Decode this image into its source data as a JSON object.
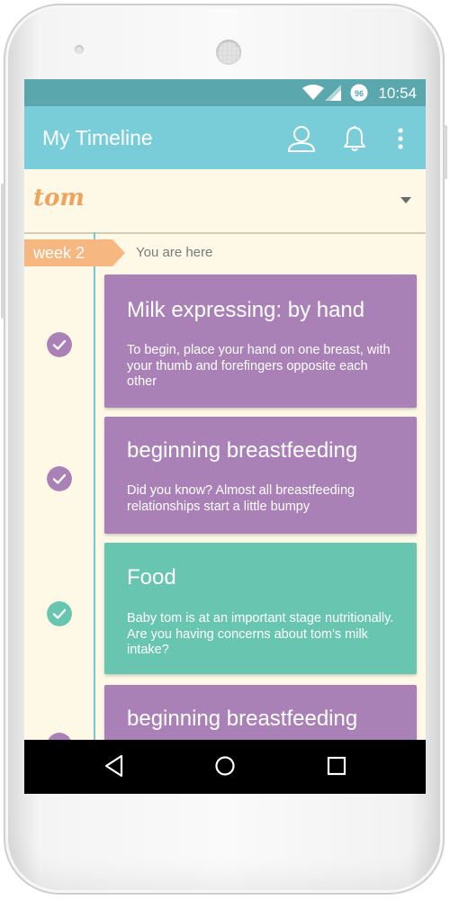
{
  "status_bar": {
    "time": "10:54",
    "icons": [
      "wifi-icon",
      "signal-icon",
      "notification-96-icon"
    ],
    "notification_badge": "96"
  },
  "app_bar": {
    "title": "My Timeline",
    "actions": [
      "profile-icon",
      "bell-icon",
      "more-vert-icon"
    ]
  },
  "child_selector": {
    "name": "tom"
  },
  "timeline": {
    "week_label": "week 2",
    "position_label": "You are here"
  },
  "cards": [
    {
      "title": "Milk expressing: by hand",
      "body": "To begin, place your hand on one breast, with your thumb and forefingers opposite each other",
      "color": "#a981b6",
      "completed": true
    },
    {
      "title": "beginning breastfeeding",
      "body": "Did you know? Almost all breastfeeding relationships start a little bumpy",
      "color": "#a981b6",
      "completed": true
    },
    {
      "title": "Food",
      "body": "Baby tom is at an important stage nutritionally. Are you having concerns about tom's milk intake?",
      "color": "#67c5b0",
      "completed": true
    },
    {
      "title": "beginning breastfeeding",
      "body": "",
      "color": "#a981b6",
      "completed": true
    }
  ],
  "nav_bar": {
    "buttons": [
      "back-icon",
      "home-icon",
      "recents-icon"
    ]
  },
  "colors": {
    "status_bar": "#5aa7ad",
    "app_bar": "#78cdd8",
    "background": "#fdf9e6",
    "week_tag": "#f6b780",
    "child_name": "#f0a35c",
    "purple_card": "#a981b6",
    "teal_card": "#67c5b0"
  }
}
